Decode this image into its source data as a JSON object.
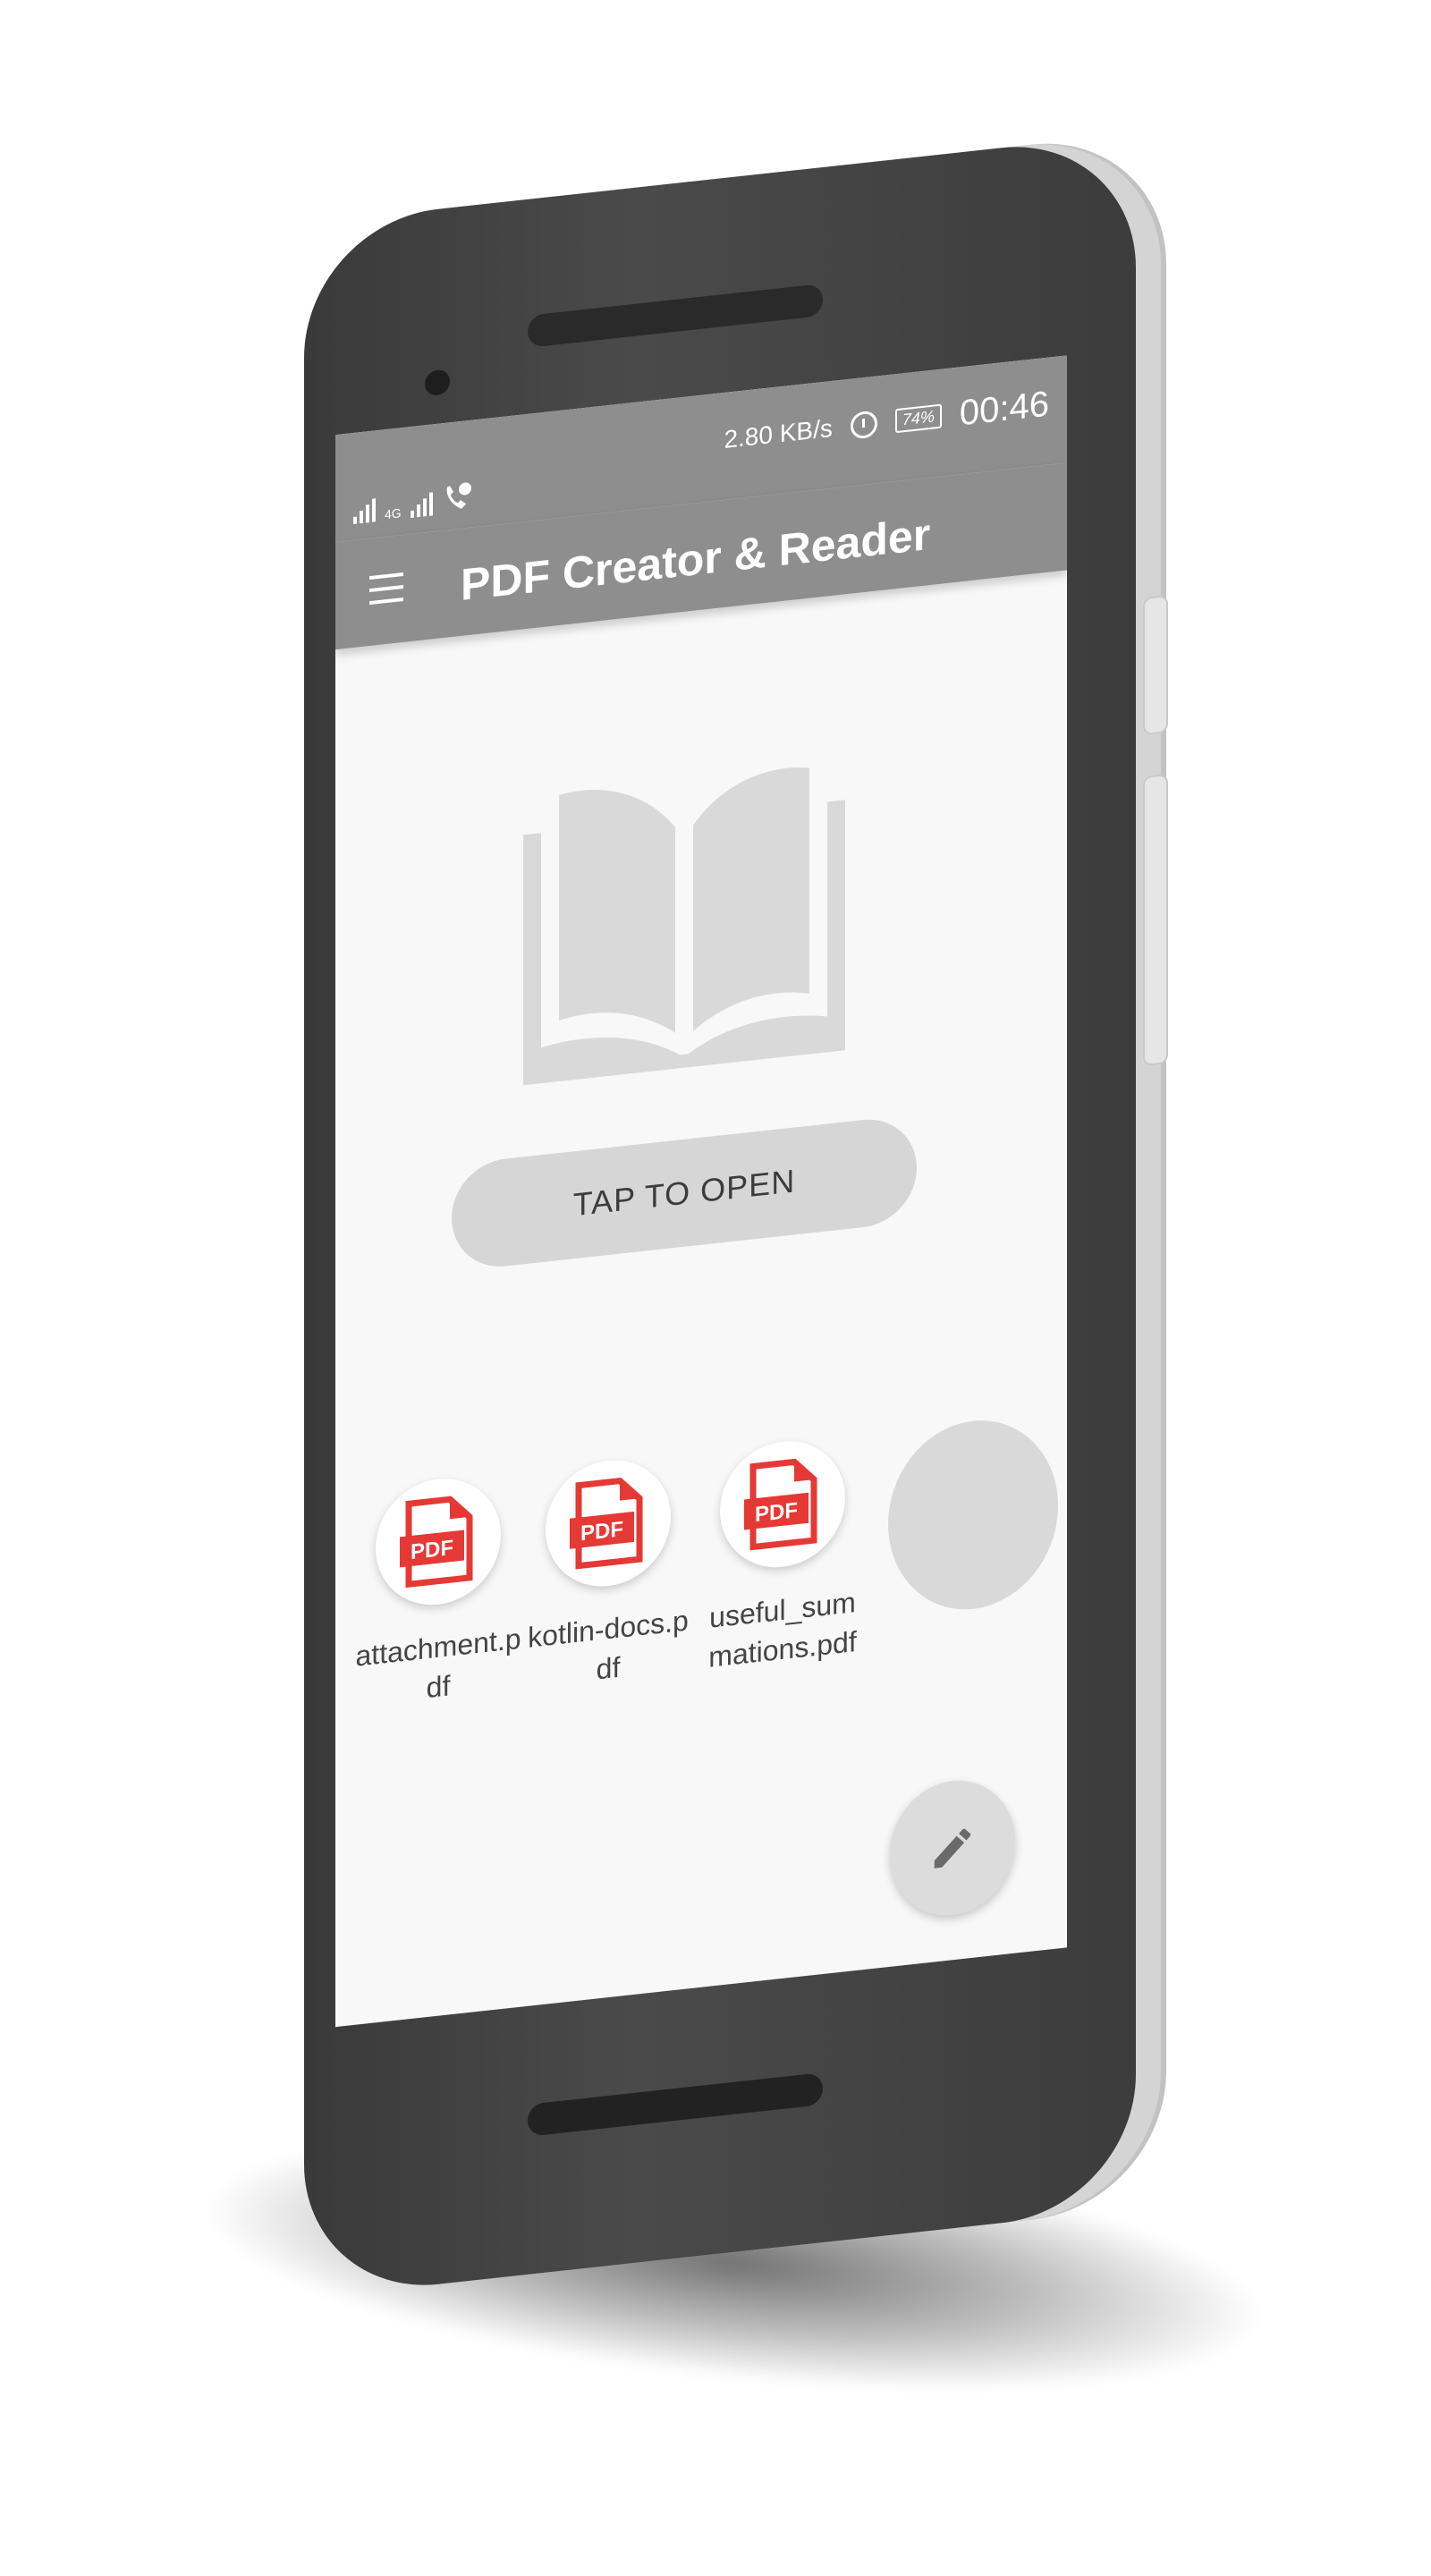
{
  "status_bar": {
    "network_type": "4G",
    "speed": "2.80 KB/s",
    "battery": "74%",
    "time": "00:46",
    "icons": [
      "signal-icon",
      "signal-icon",
      "voice-call-icon",
      "alarm-icon",
      "battery-icon"
    ]
  },
  "app_bar": {
    "title": "PDF Creator & Reader",
    "menu_icon": "menu-icon"
  },
  "main": {
    "hero_icon": "open-book-icon",
    "open_button_label": "TAP TO OPEN"
  },
  "recent_files": [
    {
      "name": "attachment.pdf",
      "icon": "pdf-icon",
      "icon_label": "PDF"
    },
    {
      "name": "kotlin-docs.pdf",
      "icon": "pdf-icon",
      "icon_label": "PDF"
    },
    {
      "name": "useful_summations.pdf",
      "icon": "pdf-icon",
      "icon_label": "PDF"
    }
  ],
  "fab": {
    "icon": "pencil-icon"
  },
  "colors": {
    "app_bar": "#8e8e8e",
    "background": "#f8f8f8",
    "pdf_red": "#e53935",
    "button_gray": "#d6d6d6",
    "phone_body": "#3d3d3d"
  }
}
